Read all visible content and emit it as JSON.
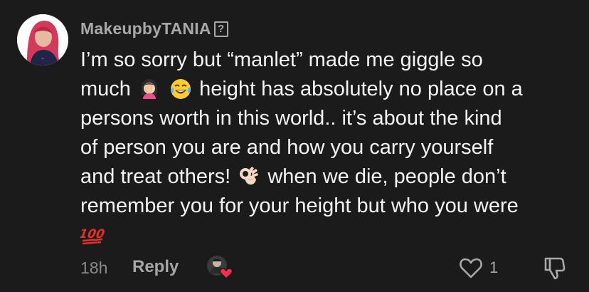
{
  "comment": {
    "username": "MakeupbyTANIA",
    "username_suffix_glyph": "?",
    "text_lines": [
      "I’m so sorry but “manlet” made me giggle so",
      "much",
      "height has absolutely no place on a",
      "persons worth in this world.. it’s about the kind",
      "of person you are and how you carry yourself",
      "and treat others!",
      "when we die, people don’t",
      "remember you for your height but who you were"
    ],
    "emojis": {
      "line2_first": "woman-facepalming-emoji",
      "line2_second": "tears-of-joy-emoji",
      "line6": "ok-hand-emoji",
      "line9": "hundred-points-emoji"
    },
    "hundred_text": "100",
    "timestamp": "18h",
    "reply_label": "Reply",
    "like_count": "1"
  },
  "colors": {
    "background": "#1b1b1b",
    "text": "#f4f4f4",
    "muted": "#a8a8a8",
    "heart_red": "#fe2c55",
    "hundred_red": "#e0312c"
  },
  "icons": {
    "avatar": "user-avatar",
    "like": "heart-outline-icon",
    "dislike": "thumbs-down-icon",
    "creator_like": "creator-liked-badge"
  }
}
